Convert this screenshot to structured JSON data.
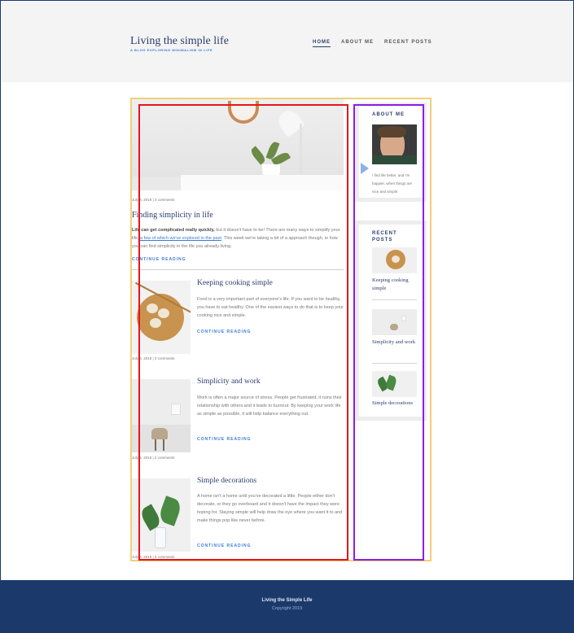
{
  "header": {
    "site_title": "Living the simple life",
    "tagline": "A BLOG EXPLORING MINIMALISM IN LIFE",
    "nav": [
      "HOME",
      "ABOUT ME",
      "RECENT POSTS"
    ]
  },
  "posts": [
    {
      "meta": "July 3, 2019  |  3 comments",
      "title": "Finding simplicity in life",
      "excerpt_bold": "Life can get complicated really quickly,",
      "excerpt_mid": " but it doesn't have to be! There are many ways to simplify your life, ",
      "excerpt_link": "a few of which we've explored in the past",
      "excerpt_end": ". This week we're taking a bit of a approach though, in how you can find simplicity in the life you already living.",
      "continue": "CONTINUE READING"
    },
    {
      "meta": "July 6, 2019  |  3 comments",
      "title": "Keeping cooking simple",
      "excerpt": "Food is a very important part of everyone's life. If you want to be healthy, you have to eat healthy. One of the easiest ways to do that is to keep your cooking nice and simple.",
      "continue": "CONTINUE READING"
    },
    {
      "meta": "July 5, 2019  |  3 comments",
      "title": "Simplicity and work",
      "excerpt": "Work is often a major source of stress. People get frustrated, it ruins their relationship with others and it leads to burnout. By keeping your work life as simple as possible, it will help balance everything out.",
      "continue": "CONTINUE READING"
    },
    {
      "meta": "July 3, 2019  |  3 comments",
      "title": "Simple decorations",
      "excerpt": "A home isn't a home until you've decorated a little. People either don't decorate, or they go overboard and it doesn't have the impact they were hoping for. Staying simple will help draw the eye where you want it to and make things pop like never before.",
      "continue": "CONTINUE READING"
    }
  ],
  "sidebar": {
    "about_title": "ABOUT ME",
    "about_text": "I find life better, and I'm happier, when things are nice and simple.",
    "recent_title_1": "RECENT",
    "recent_title_2": "POSTS",
    "recent_posts": [
      "Keeping cooking simple",
      "Simplicity and work",
      "Simple decorations"
    ]
  },
  "footer": {
    "title": "Living the Simple Life",
    "copyright": "Copyright 2019"
  },
  "colors": {
    "navy": "#1b3a6b",
    "accent": "#3a7bd5",
    "annotation_yellow": "#f2cf7a",
    "annotation_red": "#e8141c",
    "annotation_purple": "#8b1ee8"
  }
}
